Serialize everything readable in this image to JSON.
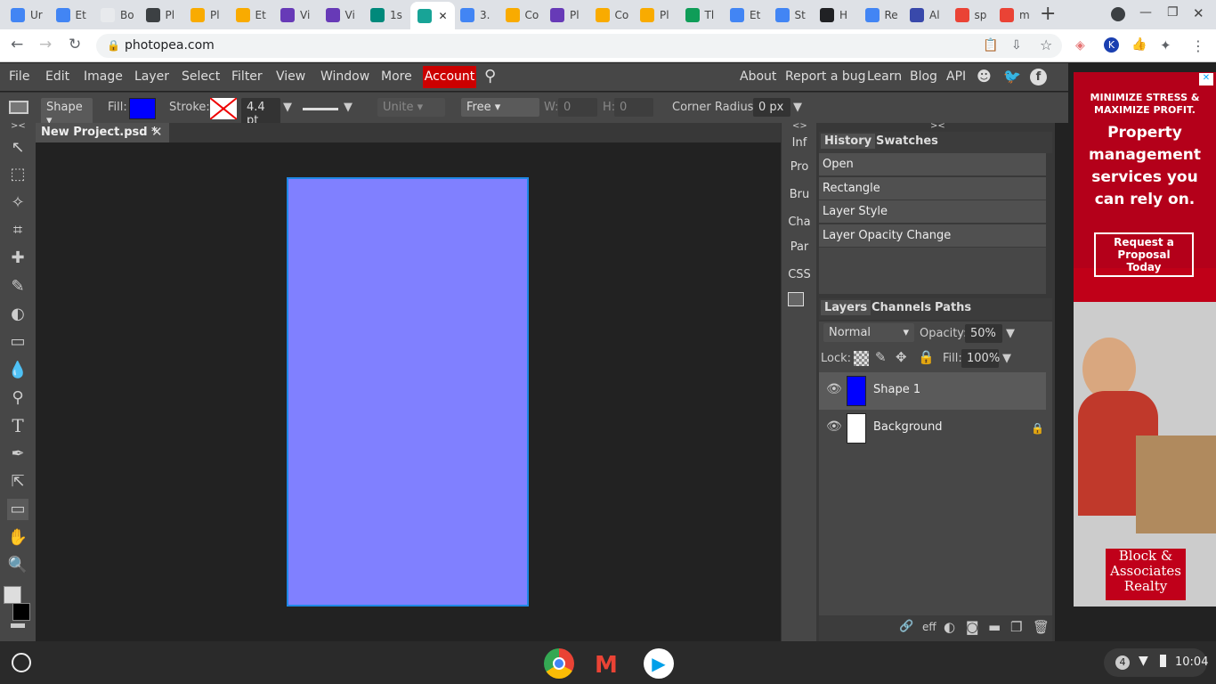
{
  "browser": {
    "tabs": [
      {
        "label": "Ur",
        "color": "#4285f4"
      },
      {
        "label": "Et",
        "color": "#4285f4"
      },
      {
        "label": "Bo",
        "color": "#e8eaed"
      },
      {
        "label": "Pl",
        "color": "#3c4043"
      },
      {
        "label": "Pl",
        "color": "#f9ab00"
      },
      {
        "label": "Et",
        "color": "#f9ab00"
      },
      {
        "label": "Vi",
        "color": "#673ab7"
      },
      {
        "label": "Vi",
        "color": "#673ab7"
      },
      {
        "label": "1s",
        "color": "#00897b"
      },
      {
        "label": "",
        "color": "#18a497",
        "active": true
      },
      {
        "label": "3.",
        "color": "#4285f4"
      },
      {
        "label": "Co",
        "color": "#f9ab00"
      },
      {
        "label": "Pl",
        "color": "#673ab7"
      },
      {
        "label": "Co",
        "color": "#f9ab00"
      },
      {
        "label": "Pl",
        "color": "#f9ab00"
      },
      {
        "label": "Tl",
        "color": "#0f9d58"
      },
      {
        "label": "Et",
        "color": "#4285f4"
      },
      {
        "label": "St",
        "color": "#4285f4"
      },
      {
        "label": "H",
        "color": "#202124"
      },
      {
        "label": "Re",
        "color": "#4285f4"
      },
      {
        "label": "Al",
        "color": "#3949ab"
      },
      {
        "label": "sp",
        "color": "#ea4335"
      },
      {
        "label": "m",
        "color": "#ea4335"
      }
    ],
    "url": "photopea.com"
  },
  "menu": {
    "items": [
      "File",
      "Edit",
      "Image",
      "Layer",
      "Select",
      "Filter",
      "View",
      "Window",
      "More"
    ],
    "account": "Account",
    "right": [
      "About",
      "Report a bug",
      "Learn",
      "Blog",
      "API"
    ]
  },
  "options": {
    "shape_mode": "Shape",
    "fill_label": "Fill:",
    "fill_color": "#0000ff",
    "stroke_label": "Stroke:",
    "stroke_width": "4.4 pt",
    "unite": "Unite",
    "free": "Free",
    "w_label": "W:",
    "w_value": "0",
    "h_label": "H:",
    "h_value": "0",
    "corner_label": "Corner Radius:",
    "corner_value": "0 px"
  },
  "document": {
    "tab_title": "New Project.psd *",
    "shape_color": "#8080ff"
  },
  "side_tabs": [
    "Inf",
    "Pro",
    "Bru",
    "Cha",
    "Par",
    "CSS"
  ],
  "history": {
    "tabs": [
      "History",
      "Swatches"
    ],
    "items": [
      "Open",
      "Rectangle",
      "Layer Style",
      "Layer Opacity Change"
    ]
  },
  "layers": {
    "tabs": [
      "Layers",
      "Channels",
      "Paths"
    ],
    "blend_mode": "Normal",
    "opacity_label": "Opacity:",
    "opacity_value": "50%",
    "lock_label": "Lock:",
    "fill_label": "Fill:",
    "fill_value": "100%",
    "items": [
      {
        "name": "Shape 1",
        "thumb": "#0000ff",
        "selected": true
      },
      {
        "name": "Background",
        "thumb": "#ffffff",
        "locked": true
      }
    ],
    "footer_eff": "eff"
  },
  "ad": {
    "headline": "MINIMIZE STRESS & MAXIMIZE PROFIT.",
    "body": "Property management services you can rely on.",
    "cta": "Request a Proposal Today",
    "brand": "Block & Associates Realty"
  },
  "shelf": {
    "notification_count": "4",
    "time": "10:04"
  }
}
